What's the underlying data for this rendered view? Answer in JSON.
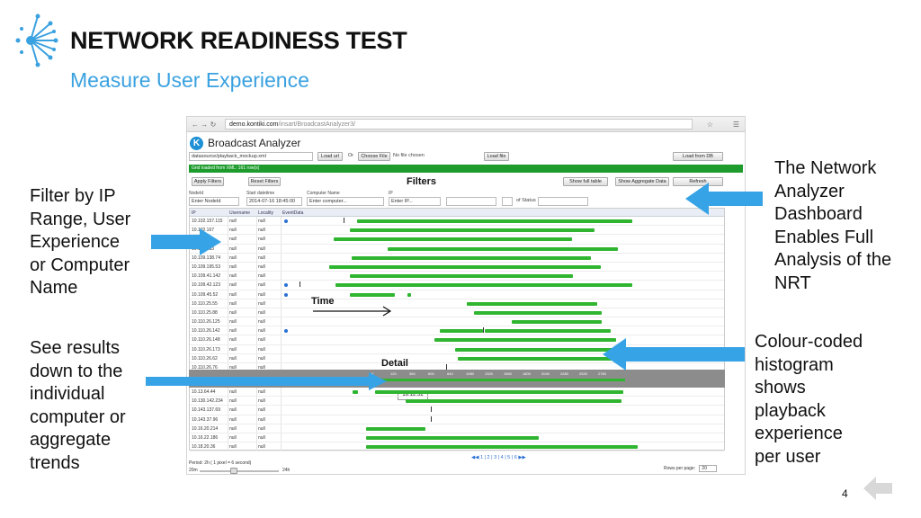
{
  "slide": {
    "title": "NETWORK READINESS TEST",
    "subtitle": "Measure User Experience",
    "page_number": "4",
    "colors": {
      "accent_blue": "#3aa1e0",
      "arrow_blue": "#36a3e6",
      "bar_green": "#2fb52f"
    }
  },
  "callouts": {
    "left_top": [
      "Filter by IP",
      "Range, User",
      "Experience",
      "or Computer",
      "Name"
    ],
    "left_bottom": [
      "See results",
      "down to the",
      "individual",
      "computer or",
      "aggregate",
      "trends"
    ],
    "right_top": [
      "The Network",
      "Analyzer",
      "Dashboard",
      "Enables Full",
      "Analysis of the",
      "NRT"
    ],
    "right_bottom": [
      "Colour-coded",
      "histogram",
      "shows",
      "playback",
      "experience",
      "per user"
    ]
  },
  "browser": {
    "url_host": "demo.kontiki.com",
    "url_path": "/insart/BroadcastAnalyzer3/",
    "app_title": "Broadcast Analyzer",
    "logo_letter": "K"
  },
  "toolbar": {
    "datasource_value": "datasource/playback_mockup.xml",
    "load_url": "Load url",
    "or": "Or",
    "choose_file": "Choose File",
    "no_file": "No file chosen",
    "load_file": "Load file",
    "load_from_db": "Load from DB"
  },
  "status": {
    "loaded_text": "Grid loaded from XML: 161 row(s)"
  },
  "filters": {
    "heading": "Filters",
    "apply": "Apply Filters",
    "reset": "Reset Filters",
    "show_full_table": "Show full table",
    "show_aggregate": "Show Aggregate Data",
    "refresh": "Refresh",
    "label_nodeid": "NodeId",
    "label_start": "Start datetime",
    "label_computer": "Computer Name",
    "label_ip": "IP",
    "nodeid_placeholder": "Enter NodeId",
    "start_value": "2014-07-16 18:45:00",
    "computer_placeholder": "Enter computer...",
    "ip_placeholder": "Enter IP...",
    "of_status": "of Status"
  },
  "grid": {
    "columns": [
      "IP",
      "Username",
      "Locality",
      "EventData"
    ],
    "rows": [
      {
        "ip": "10.102.157.115",
        "user": "null",
        "loc": "null"
      },
      {
        "ip": "10.102.167",
        "user": "null",
        "loc": "null"
      },
      {
        "ip": "10.103",
        "user": "null",
        "loc": "null"
      },
      {
        "ip": "10.109.183",
        "user": "null",
        "loc": "null"
      },
      {
        "ip": "10.109.138.74",
        "user": "null",
        "loc": "null"
      },
      {
        "ip": "10.109.195.53",
        "user": "null",
        "loc": "null"
      },
      {
        "ip": "10.109.41.142",
        "user": "null",
        "loc": "null"
      },
      {
        "ip": "10.109.42.123",
        "user": "null",
        "loc": "null"
      },
      {
        "ip": "10.109.45.52",
        "user": "null",
        "loc": "null"
      },
      {
        "ip": "10.110.25.55",
        "user": "null",
        "loc": "null"
      },
      {
        "ip": "10.110.25.88",
        "user": "null",
        "loc": "null"
      },
      {
        "ip": "10.110.26.125",
        "user": "null",
        "loc": "null"
      },
      {
        "ip": "10.110.26.142",
        "user": "null",
        "loc": "null"
      },
      {
        "ip": "10.110.26.148",
        "user": "null",
        "loc": "null"
      },
      {
        "ip": "10.110.26.173",
        "user": "null",
        "loc": "null"
      },
      {
        "ip": "10.110.26.62",
        "user": "null",
        "loc": "null"
      },
      {
        "ip": "10.110.26.76",
        "user": "null",
        "loc": "null"
      }
    ],
    "rows_bottom": [
      {
        "ip": "10.13.64.44",
        "user": "null",
        "loc": "null"
      },
      {
        "ip": "10.130.142.234",
        "user": "null",
        "loc": "null"
      },
      {
        "ip": "10.143.137.69",
        "user": "null",
        "loc": "null"
      },
      {
        "ip": "10.143.37.96",
        "user": "null",
        "loc": "null"
      },
      {
        "ip": "10.16.20.214",
        "user": "null",
        "loc": "null"
      },
      {
        "ip": "10.16.22.186",
        "user": "null",
        "loc": "null"
      },
      {
        "ip": "10.18.20.36",
        "user": "null",
        "loc": "null"
      }
    ]
  },
  "labels": {
    "time": "Time",
    "detail": "Detail",
    "time_tip": "19:12:52"
  },
  "footer": {
    "pager": "1 | 2 | 3 | 4 | 5 | 6",
    "period": "Period: 2h ( 1 pixel = 6 second)",
    "zoom_min": "20m",
    "zoom_max": "24h",
    "rows_per_page_label": "Rows per page:",
    "rows_per_page_value": "20"
  }
}
